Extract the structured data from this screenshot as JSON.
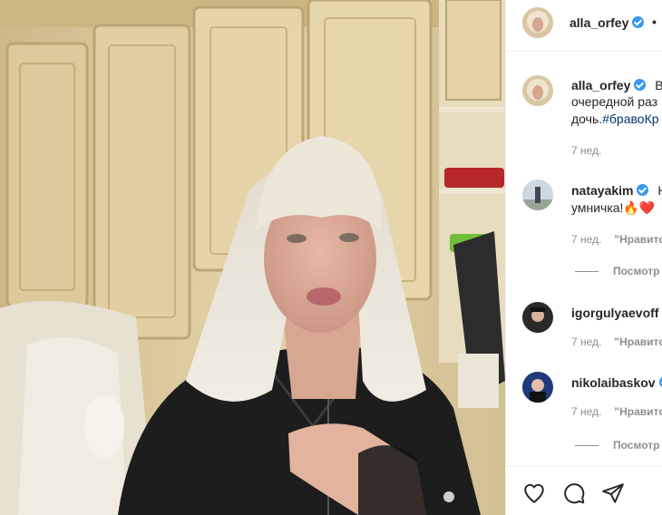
{
  "post": {
    "author": "alla_orfey",
    "follow_dot": "•",
    "caption": {
      "line1": "Вч",
      "line2": "очередной раз",
      "line3": "дочь.",
      "hashtag": "#бравоКр",
      "time": "7 нед."
    }
  },
  "comments": [
    {
      "username": "natayakim",
      "verified": true,
      "text_line1": "Н",
      "text_line2": "умничка!🔥❤️",
      "time": "7 нед.",
      "reply": "\"Нравито",
      "views": "Посмотр"
    },
    {
      "username": "igorgulyaevoff",
      "verified": false,
      "time": "7 нед.",
      "reply": "\"Нравито"
    },
    {
      "username": "nikolaibaskov",
      "verified": true,
      "time": "7 нед.",
      "reply": "\"Нравито",
      "views": "Посмотр"
    }
  ],
  "actions": {
    "like_icon": "heart-icon",
    "comment_icon": "comment-icon",
    "share_icon": "share-icon"
  },
  "colors": {
    "verified": "#3897f0",
    "hashtag": "#00376b",
    "muted": "#8e8e8e",
    "text": "#262626"
  }
}
